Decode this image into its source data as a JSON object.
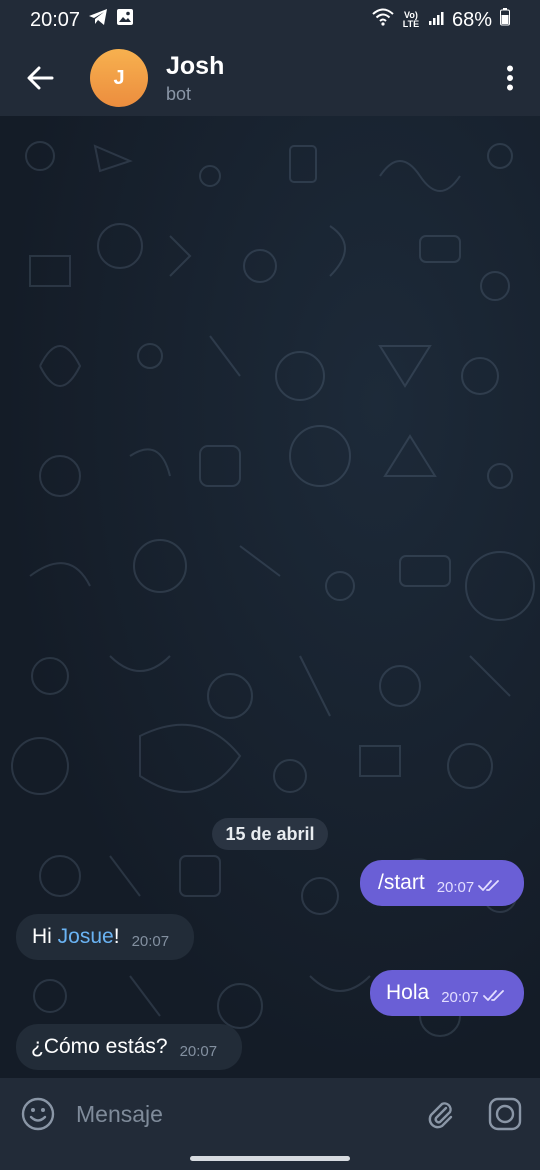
{
  "status_bar": {
    "time": "20:07",
    "battery": "68%",
    "network_label": "Vo) LTE"
  },
  "header": {
    "avatar_letter": "J",
    "name": "Josh",
    "subtitle": "bot"
  },
  "chat": {
    "date": "15 de abril",
    "messages": [
      {
        "direction": "out",
        "text": "/start",
        "time": "20:07"
      },
      {
        "direction": "in",
        "text_before": "Hi ",
        "link": "Josue",
        "text_after": "!",
        "time": "20:07"
      },
      {
        "direction": "out",
        "text": "Hola",
        "time": "20:07"
      },
      {
        "direction": "in",
        "text": "¿Cómo estás?",
        "time": "20:07"
      }
    ]
  },
  "input": {
    "placeholder": "Mensaje"
  },
  "colors": {
    "accent": "#6a5fd6",
    "link": "#6ab3f3",
    "avatar": "#ec8d3e"
  }
}
